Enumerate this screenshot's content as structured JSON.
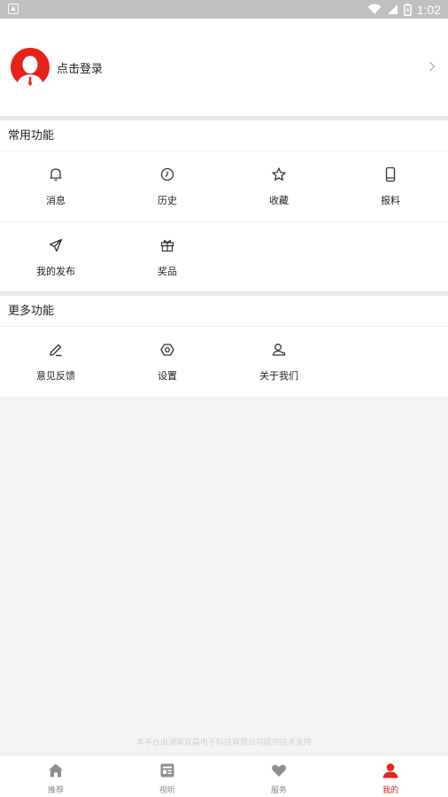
{
  "status_bar": {
    "time": "1:02"
  },
  "profile": {
    "login_label": "点击登录"
  },
  "common": {
    "title": "常用功能",
    "items": [
      {
        "label": "消息",
        "icon": "bell-icon"
      },
      {
        "label": "历史",
        "icon": "clock-icon"
      },
      {
        "label": "收藏",
        "icon": "star-icon"
      },
      {
        "label": "报料",
        "icon": "phone-icon"
      },
      {
        "label": "我的发布",
        "icon": "send-icon"
      },
      {
        "label": "奖品",
        "icon": "gift-icon"
      }
    ]
  },
  "more": {
    "title": "更多功能",
    "items": [
      {
        "label": "意见反馈",
        "icon": "pencil-icon"
      },
      {
        "label": "设置",
        "icon": "settings-icon"
      },
      {
        "label": "关于我们",
        "icon": "user-about-icon"
      }
    ]
  },
  "footer_note": "本平台由湖南双晨电子科技有限公司提供技术支持",
  "tabbar": {
    "items": [
      {
        "label": "推荐",
        "icon": "home-icon"
      },
      {
        "label": "视听",
        "icon": "media-icon"
      },
      {
        "label": "服务",
        "icon": "heart-icon"
      },
      {
        "label": "我的",
        "icon": "profile-icon"
      }
    ],
    "active_color": "#e6231b",
    "inactive_color": "#888888"
  }
}
